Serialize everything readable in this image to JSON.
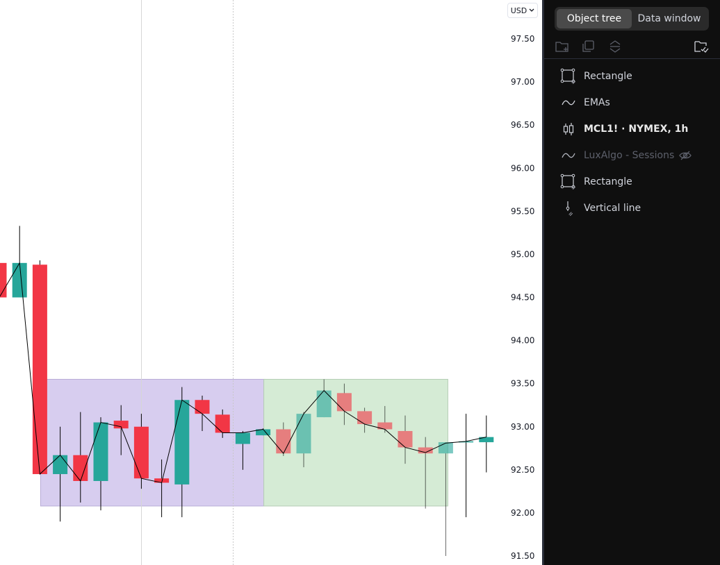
{
  "chart": {
    "currency_label": "USD",
    "price_ticks": [
      "97.50",
      "97.00",
      "96.50",
      "96.00",
      "95.50",
      "95.00",
      "94.50",
      "94.00",
      "93.50",
      "93.00",
      "92.50",
      "92.00",
      "91.50"
    ],
    "colors": {
      "up": "#26a69a",
      "down": "#f23645",
      "ema": "#000000",
      "rect_session1": "#d7cdef",
      "rect_session2": "#d5ebd5"
    }
  },
  "chart_data": {
    "type": "candlestick",
    "ylim": [
      91.5,
      97.5
    ],
    "candles": [
      {
        "open": 94.9,
        "high": 94.9,
        "low": 94.5,
        "close": 94.5,
        "dim": false
      },
      {
        "open": 94.5,
        "high": 95.33,
        "low": 94.5,
        "close": 94.9,
        "dim": false
      },
      {
        "open": 94.88,
        "high": 94.93,
        "low": 92.45,
        "close": 92.45,
        "dim": false
      },
      {
        "open": 92.45,
        "high": 93.0,
        "low": 91.9,
        "close": 92.67,
        "dim": false
      },
      {
        "open": 92.67,
        "high": 93.17,
        "low": 92.12,
        "close": 92.37,
        "dim": false
      },
      {
        "open": 92.37,
        "high": 93.11,
        "low": 92.03,
        "close": 93.05,
        "dim": false
      },
      {
        "open": 93.07,
        "high": 93.25,
        "low": 92.67,
        "close": 92.98,
        "dim": false
      },
      {
        "open": 93.0,
        "high": 93.15,
        "low": 92.28,
        "close": 92.4,
        "dim": false
      },
      {
        "open": 92.4,
        "high": 92.62,
        "low": 91.95,
        "close": 92.35,
        "dim": false
      },
      {
        "open": 92.33,
        "high": 93.46,
        "low": 91.95,
        "close": 93.31,
        "dim": false
      },
      {
        "open": 93.31,
        "high": 93.36,
        "low": 92.95,
        "close": 93.15,
        "dim": false
      },
      {
        "open": 93.14,
        "high": 93.2,
        "low": 92.87,
        "close": 92.93,
        "dim": false
      },
      {
        "open": 92.8,
        "high": 92.95,
        "low": 92.5,
        "close": 92.93,
        "dim": false
      },
      {
        "open": 92.9,
        "high": 92.98,
        "low": 92.9,
        "close": 92.97,
        "dim": false
      },
      {
        "open": 92.97,
        "high": 93.05,
        "low": 92.66,
        "close": 92.69,
        "dim": true
      },
      {
        "open": 92.69,
        "high": 93.17,
        "low": 92.53,
        "close": 93.15,
        "dim": true
      },
      {
        "open": 93.11,
        "high": 93.55,
        "low": 93.11,
        "close": 93.42,
        "dim": true
      },
      {
        "open": 93.39,
        "high": 93.5,
        "low": 93.02,
        "close": 93.18,
        "dim": true
      },
      {
        "open": 93.18,
        "high": 93.22,
        "low": 92.93,
        "close": 93.03,
        "dim": true
      },
      {
        "open": 93.05,
        "high": 93.24,
        "low": 92.93,
        "close": 92.97,
        "dim": true
      },
      {
        "open": 92.95,
        "high": 93.13,
        "low": 92.57,
        "close": 92.76,
        "dim": true
      },
      {
        "open": 92.76,
        "high": 92.88,
        "low": 92.05,
        "close": 92.69,
        "dim": true
      },
      {
        "open": 92.69,
        "high": 92.82,
        "low": 91.5,
        "close": 92.82,
        "dim": true
      },
      {
        "open": 92.82,
        "high": 93.15,
        "low": 91.95,
        "close": 92.83,
        "dim": false
      },
      {
        "open": 92.82,
        "high": 93.13,
        "low": 92.47,
        "close": 92.88,
        "dim": false
      }
    ],
    "ema": [
      94.5,
      94.9,
      92.45,
      92.67,
      92.37,
      93.05,
      93.0,
      92.4,
      92.35,
      93.31,
      93.15,
      92.93,
      92.93,
      92.97,
      92.69,
      93.15,
      93.42,
      93.18,
      93.03,
      92.97,
      92.76,
      92.7,
      92.81,
      92.83,
      92.88
    ],
    "rectangles": [
      {
        "from_index": 2,
        "to_index": 13,
        "top": 93.55,
        "bottom": 92.08,
        "color": "#d7cdef",
        "border": "#b8abd6"
      },
      {
        "from_index": 13,
        "to_index": 22,
        "top": 93.55,
        "bottom": 92.08,
        "color": "#d5ebd5",
        "border": "#b3ccb3"
      }
    ],
    "vertical_lines": [
      {
        "at_index": 7,
        "style": "solid",
        "color": "#d6d6d6"
      },
      {
        "at_index": 11.5,
        "style": "dotted",
        "color": "#c8c8c8"
      }
    ]
  },
  "panel": {
    "tabs": [
      {
        "label": "Object tree",
        "active": true
      },
      {
        "label": "Data window",
        "active": false
      }
    ],
    "toolbar": [
      "new-folder-icon",
      "clone-icon",
      "sort-icon",
      "select-all-icon"
    ],
    "items": [
      {
        "label": "Rectangle",
        "icon": "rectangle-icon",
        "bold": false,
        "hidden": false
      },
      {
        "label": "EMAs",
        "icon": "indicator-wave-icon",
        "bold": false,
        "hidden": false
      },
      {
        "label": "MCL1! · NYMEX, 1h",
        "icon": "candles-icon",
        "bold": true,
        "hidden": false
      },
      {
        "label": "LuxAlgo - Sessions",
        "icon": "indicator-wave-icon",
        "bold": false,
        "hidden": true
      },
      {
        "label": "Rectangle",
        "icon": "rectangle-icon",
        "bold": false,
        "hidden": false
      },
      {
        "label": "Vertical line",
        "icon": "vertical-line-icon",
        "bold": false,
        "hidden": false
      }
    ]
  }
}
